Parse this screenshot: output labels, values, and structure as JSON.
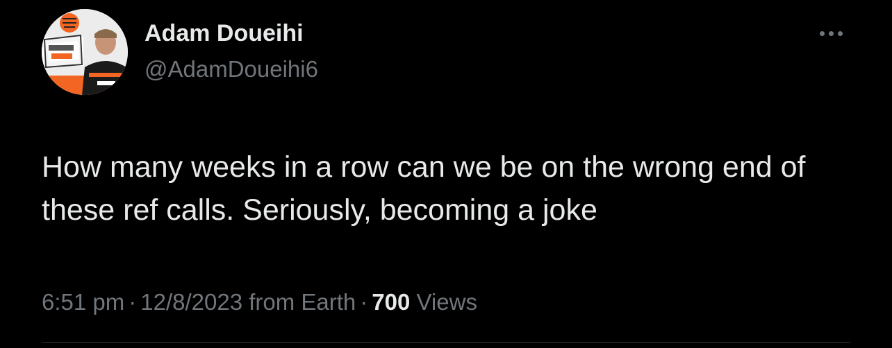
{
  "author": {
    "display_name": "Adam Doueihi",
    "handle": "@AdamDoueihi6"
  },
  "tweet": {
    "text": "How many weeks in a row can we be on the wrong end of these ref calls. Seriously, becoming a joke",
    "time": "6:51 pm",
    "date": "12/8/2023",
    "source": "from Earth",
    "separator": "·",
    "views_count": "700",
    "views_label": "Views"
  },
  "icons": {
    "more": "more-horizontal-icon"
  },
  "colors": {
    "background": "#000000",
    "primary_text": "#e7e9ea",
    "secondary_text": "#71767b",
    "divider": "#2f3336",
    "accent_orange": "#f26522"
  }
}
